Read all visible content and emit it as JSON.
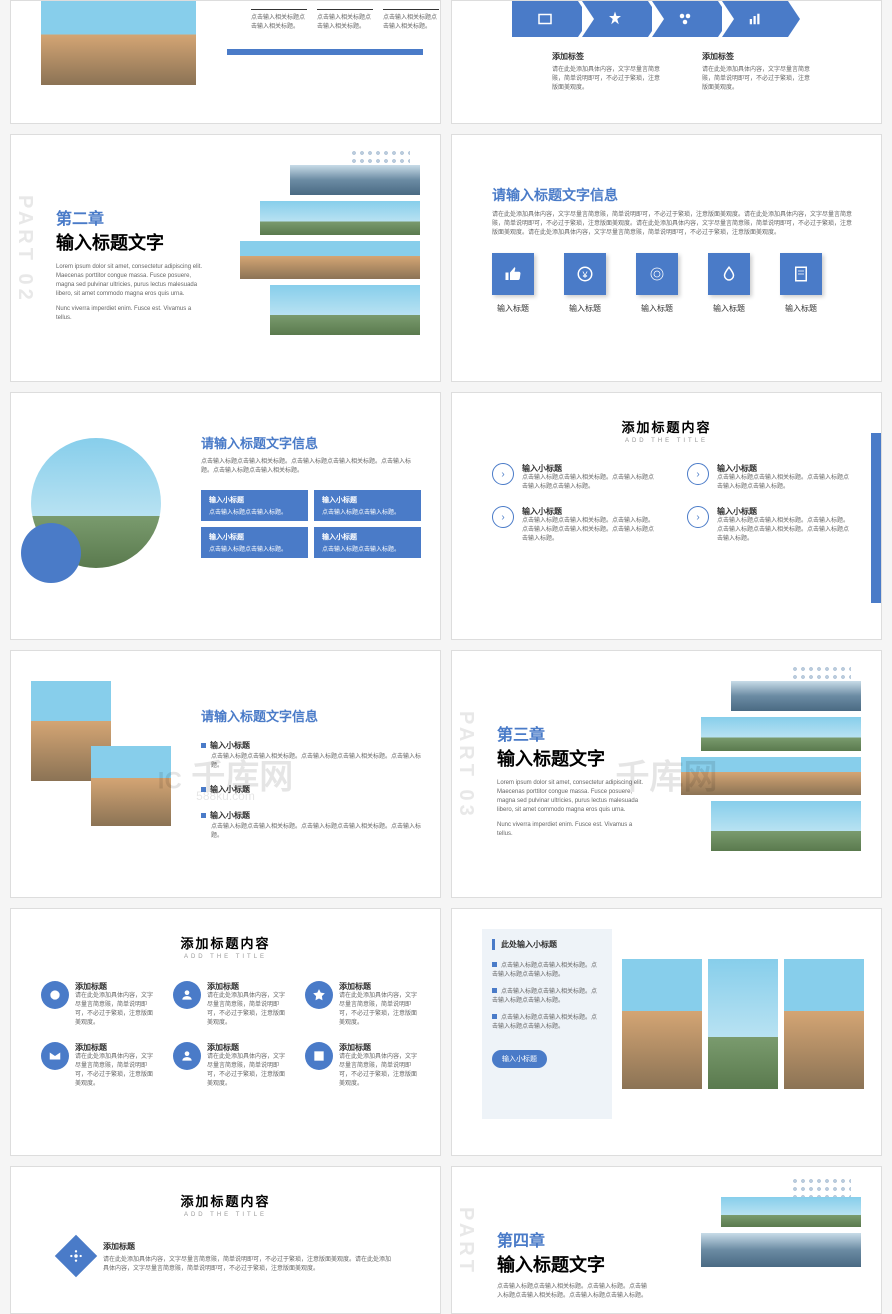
{
  "watermark": {
    "main": "千库网",
    "sub": "588ku.com",
    "logo": "IC"
  },
  "s1": {
    "cols": [
      "点击输入相关标题点击输入相关标题。",
      "点击输入相关标题点击输入相关标题。",
      "点击输入相关标题点击输入相关标题。"
    ]
  },
  "s2": {
    "t1": "添加标签",
    "t2": "添加标签",
    "d1": "请在此处添加具体内容，文字尽量言简意赅，简单说明即可，不必过于繁琐，注意版面美观度。",
    "d2": "请在此处添加具体内容，文字尽量言简意赅，简单说明即可，不必过于繁琐，注意版面美观度。"
  },
  "s3": {
    "chapter": "第二章",
    "title": "输入标题文字",
    "desc": "Lorem ipsum dolor sit amet, consectetur adipiscing elit. Maecenas porttitor congue massa. Fusce posuere, magna sed pulvinar ultricies, purus lectus malesuada libero, sit amet commodo magna eros quis urna.",
    "desc2": "Nunc viverra imperdiet enim. Fusce est. Vivamus a tellus."
  },
  "s4": {
    "title": "请输入标题文字信息",
    "desc": "请在此处添加具体内容，文字尽量言简意赅，简单说明即可，不必过于繁琐，注意版面美观度。请在此处添加具体内容，文字尽量言简意赅，简单说明即可，不必过于繁琐，注意版面美观度。请在此处添加具体内容，文字尽量言简意赅，简单说明即可，不必过于繁琐，注意版面美观度。请在此处添加具体内容，文字尽量言简意赅，简单说明即可，不必过于繁琐，注意版面美观度。",
    "items": [
      "输入标题",
      "输入标题",
      "输入标题",
      "输入标题",
      "输入标题"
    ]
  },
  "s5": {
    "title": "请输入标题文字信息",
    "desc": "点击输入标题点击输入相关标题。点击输入标题点击输入相关标题。点击输入标题。点击输入标题点击输入相关标题。",
    "boxes": [
      {
        "t": "输入小标题",
        "d": "点击输入标题点击输入标题。"
      },
      {
        "t": "输入小标题",
        "d": "点击输入标题点击输入标题。"
      },
      {
        "t": "输入小标题",
        "d": "点击输入标题点击输入标题。"
      },
      {
        "t": "输入小标题",
        "d": "点击输入标题点击输入标题。"
      }
    ]
  },
  "s6": {
    "title": "添加标题内容",
    "sub": "ADD THE TITLE",
    "items": [
      {
        "t": "输入小标题",
        "d": "点击输入标题点击输入相关标题。点击输入标题点击输入标题点击输入标题。"
      },
      {
        "t": "输入小标题",
        "d": "点击输入标题点击输入相关标题。点击输入标题点击输入标题点击输入标题。"
      },
      {
        "t": "输入小标题",
        "d": "点击输入标题点击输入相关标题。点击输入标题。点击输入标题点击输入相关标题。点击输入标题点击输入标题。"
      },
      {
        "t": "输入小标题",
        "d": "点击输入标题点击输入相关标题。点击输入标题。点击输入标题点击输入相关标题。点击输入标题点击输入标题。"
      }
    ]
  },
  "s7": {
    "title": "请输入标题文字信息",
    "items": [
      {
        "t": "输入小标题",
        "d": "点击输入标题点击输入相关标题。点击输入标题点击输入相关标题。点击输入标题。"
      },
      {
        "t": "输入小标题",
        "d": ""
      },
      {
        "t": "输入小标题",
        "d": "点击输入标题点击输入相关标题。点击输入标题点击输入相关标题。点击输入标题。"
      }
    ]
  },
  "s8": {
    "chapter": "第三章",
    "title": "输入标题文字",
    "desc": "Lorem ipsum dolor sit amet, consectetur adipiscing elit. Maecenas porttitor congue massa. Fusce posuere, magna sed pulvinar ultricies, purus lectus malesuada libero, sit amet commodo magna eros quis urna.",
    "desc2": "Nunc viverra imperdiet enim. Fusce est. Vivamus a tellus."
  },
  "s9": {
    "title": "添加标题内容",
    "sub": "ADD THE TITLE",
    "items": [
      {
        "t": "添加标题",
        "d": "请在此处添加具体内容，文字尽量言简意赅，简单说明即可，不必过于繁琐，注意版面美观度。"
      },
      {
        "t": "添加标题",
        "d": "请在此处添加具体内容，文字尽量言简意赅，简单说明即可，不必过于繁琐，注意版面美观度。"
      },
      {
        "t": "添加标题",
        "d": "请在此处添加具体内容，文字尽量言简意赅，简单说明即可，不必过于繁琐，注意版面美观度。"
      },
      {
        "t": "添加标题",
        "d": "请在此处添加具体内容，文字尽量言简意赅，简单说明即可，不必过于繁琐，注意版面美观度。"
      },
      {
        "t": "添加标题",
        "d": "请在此处添加具体内容，文字尽量言简意赅，简单说明即可，不必过于繁琐，注意版面美观度。"
      },
      {
        "t": "添加标题",
        "d": "请在此处添加具体内容，文字尽量言简意赅，简单说明即可，不必过于繁琐，注意版面美观度。"
      }
    ]
  },
  "s10": {
    "title": "此处输入小标题",
    "bullets": [
      "点击输入标题点击输入相关标题。点击输入标题点击输入标题。",
      "点击输入标题点击输入相关标题。点击输入标题点击输入标题。",
      "点击输入标题点击输入相关标题。点击输入标题点击输入标题。"
    ],
    "btn": "输入小标题"
  },
  "s11": {
    "title": "添加标题内容",
    "sub": "ADD THE TITLE",
    "item": {
      "t": "添加标题",
      "d": "请在此处添加具体内容，文字尽量言简意赅，简单说明即可，不必过于繁琐，注意版面美观度。请在此处添加具体内容，文字尽量言简意赅，简单说明即可，不必过于繁琐，注意版面美观度。"
    }
  },
  "s12": {
    "chapter": "第四章",
    "title": "输入标题文字",
    "desc": "点击输入标题点击输入相关标题。点击输入标题。点击输入标题点击输入相关标题。点击输入标题点击输入标题。"
  }
}
